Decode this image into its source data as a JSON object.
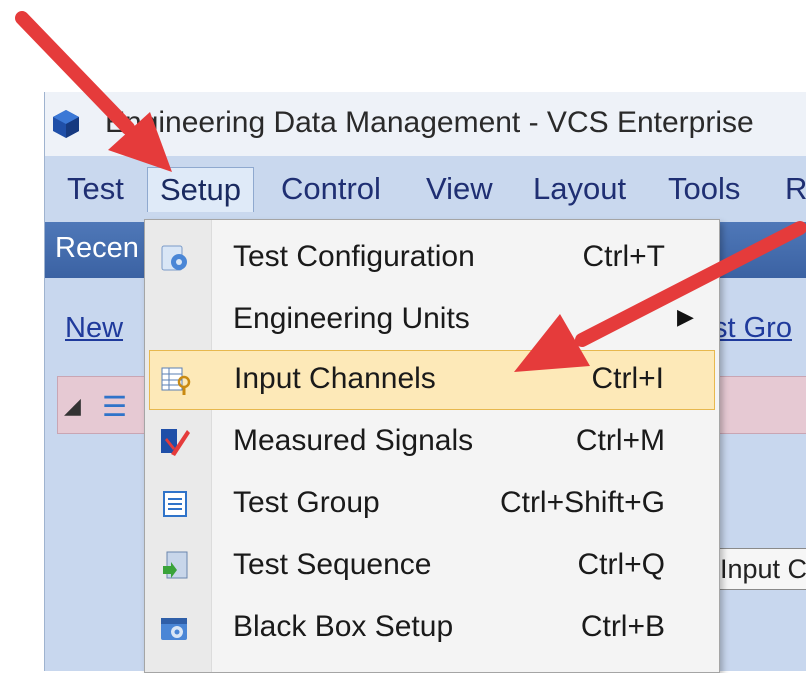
{
  "window": {
    "title": "Engineering Data Management - VCS Enterprise"
  },
  "menubar": {
    "items": [
      {
        "label": "Test"
      },
      {
        "label": "Setup"
      },
      {
        "label": "Control"
      },
      {
        "label": "View"
      },
      {
        "label": "Layout"
      },
      {
        "label": "Tools"
      },
      {
        "label": "R"
      }
    ]
  },
  "recent_bar": {
    "label": "Recen"
  },
  "panel": {
    "new_link": "New",
    "group_link": "st Gro",
    "tooltip": "Input C"
  },
  "setup_menu": {
    "items": [
      {
        "label": "Test Configuration",
        "shortcut": "Ctrl+T",
        "icon": "test-configuration-icon"
      },
      {
        "label": "Engineering Units",
        "shortcut": "",
        "submenu": "▶"
      },
      {
        "label": "Input Channels",
        "shortcut": "Ctrl+I",
        "icon": "input-channels-icon",
        "highlighted": true
      },
      {
        "label": "Measured Signals",
        "shortcut": "Ctrl+M",
        "icon": "measured-signals-icon"
      },
      {
        "label": "Test Group",
        "shortcut": "Ctrl+Shift+G",
        "icon": "test-group-icon"
      },
      {
        "label": "Test Sequence",
        "shortcut": "Ctrl+Q",
        "icon": "test-sequence-icon"
      },
      {
        "label": "Black Box Setup",
        "shortcut": "Ctrl+B",
        "icon": "black-box-setup-icon"
      }
    ]
  },
  "colors": {
    "highlight": "#fde9b8",
    "arrow": "#e53b3b",
    "menubar": "#c9d8ee"
  }
}
